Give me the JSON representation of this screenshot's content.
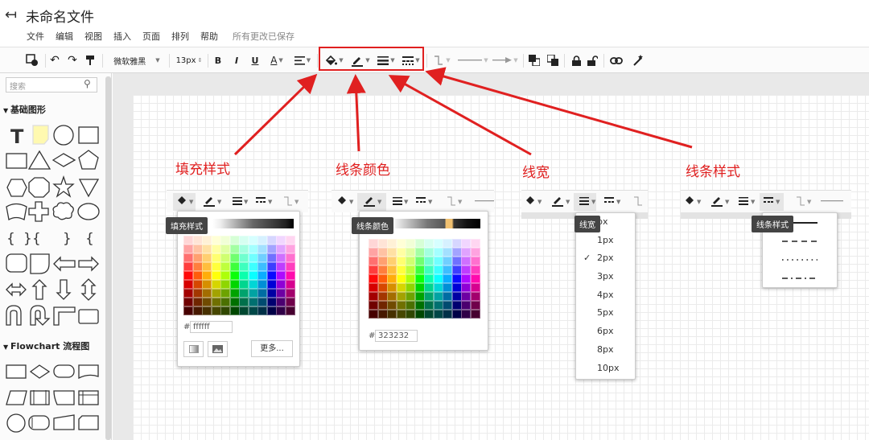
{
  "app": {
    "back_icon": "back-arrow-icon",
    "title": "未命名文件",
    "menu": [
      "文件",
      "编辑",
      "视图",
      "插入",
      "页面",
      "排列",
      "帮助"
    ],
    "save_status": "所有更改已保存"
  },
  "toolbar": {
    "font": "微软雅黑",
    "font_size": "13px",
    "bold": "B",
    "italic": "I",
    "underline": "U",
    "font_color": "A"
  },
  "sidebar": {
    "search_placeholder": "搜索",
    "section_basic": "基础图形",
    "section_flowchart": "Flowchart 流程图",
    "brace_chars": [
      "{",
      "}{",
      "}",
      "{"
    ]
  },
  "labels": {
    "fill": "填充样式",
    "line_color": "线条颜色",
    "line_width": "线宽",
    "line_style": "线条样式",
    "accent": "#e02020"
  },
  "fill_popup": {
    "tooltip": "填充样式",
    "hex_prefix": "#",
    "hex_value": "ffffff",
    "more": "更多..."
  },
  "color_popup": {
    "tooltip": "线条颜色",
    "hex_prefix": "#",
    "hex_value": "323232"
  },
  "width_popup": {
    "tooltip": "线宽",
    "options": [
      "px",
      "1px",
      "2px",
      "3px",
      "4px",
      "5px",
      "6px",
      "8px",
      "10px"
    ],
    "selected": "2px",
    "check": "✓"
  },
  "style_popup": {
    "tooltip": "线条样式"
  }
}
